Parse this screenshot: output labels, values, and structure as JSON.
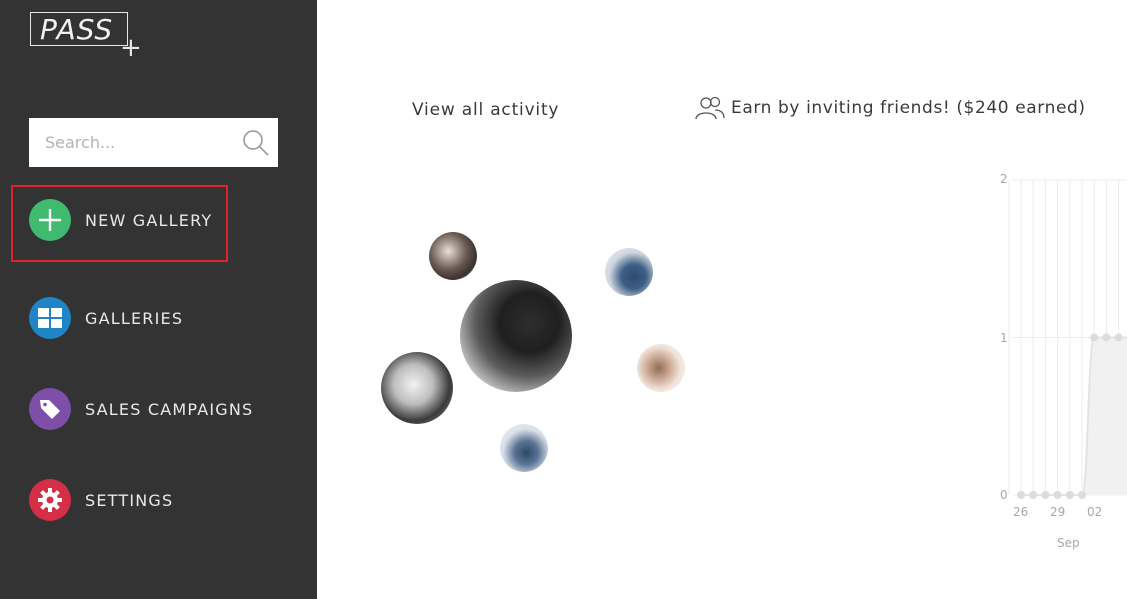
{
  "app": {
    "logo_text": "PASS",
    "logo_plus": "+"
  },
  "sidebar": {
    "search_placeholder": "Search...",
    "items": [
      {
        "label": "NEW GALLERY",
        "icon": "plus-icon",
        "color": "#3fba6e"
      },
      {
        "label": "GALLERIES",
        "icon": "grid-icon",
        "color": "#1f85c7"
      },
      {
        "label": "SALES CAMPAIGNS",
        "icon": "tag-icon",
        "color": "#7d4fa8"
      },
      {
        "label": "SETTINGS",
        "icon": "gear-icon",
        "color": "#d42f47"
      }
    ]
  },
  "main": {
    "activity_link": "View all activity",
    "invite_text": "Earn by inviting friends! ($240 earned)",
    "invite_icon": "users-icon"
  },
  "chart_data": {
    "type": "line",
    "x": [
      "26",
      "27",
      "28",
      "29",
      "30",
      "31",
      "01",
      "02",
      "03",
      "04"
    ],
    "x_tick_labels": [
      "26",
      "29",
      "02"
    ],
    "x_group_label": "Sep",
    "y": [
      0,
      0,
      0,
      0,
      0,
      0,
      1,
      1,
      1,
      1
    ],
    "y_tick_labels": [
      "2",
      "1",
      "0"
    ],
    "ylim": [
      0,
      2
    ],
    "grid": true,
    "colors": {
      "line": "#e3e3e3",
      "fill": "#f1f1f1",
      "point": "#dcdcdc"
    }
  }
}
